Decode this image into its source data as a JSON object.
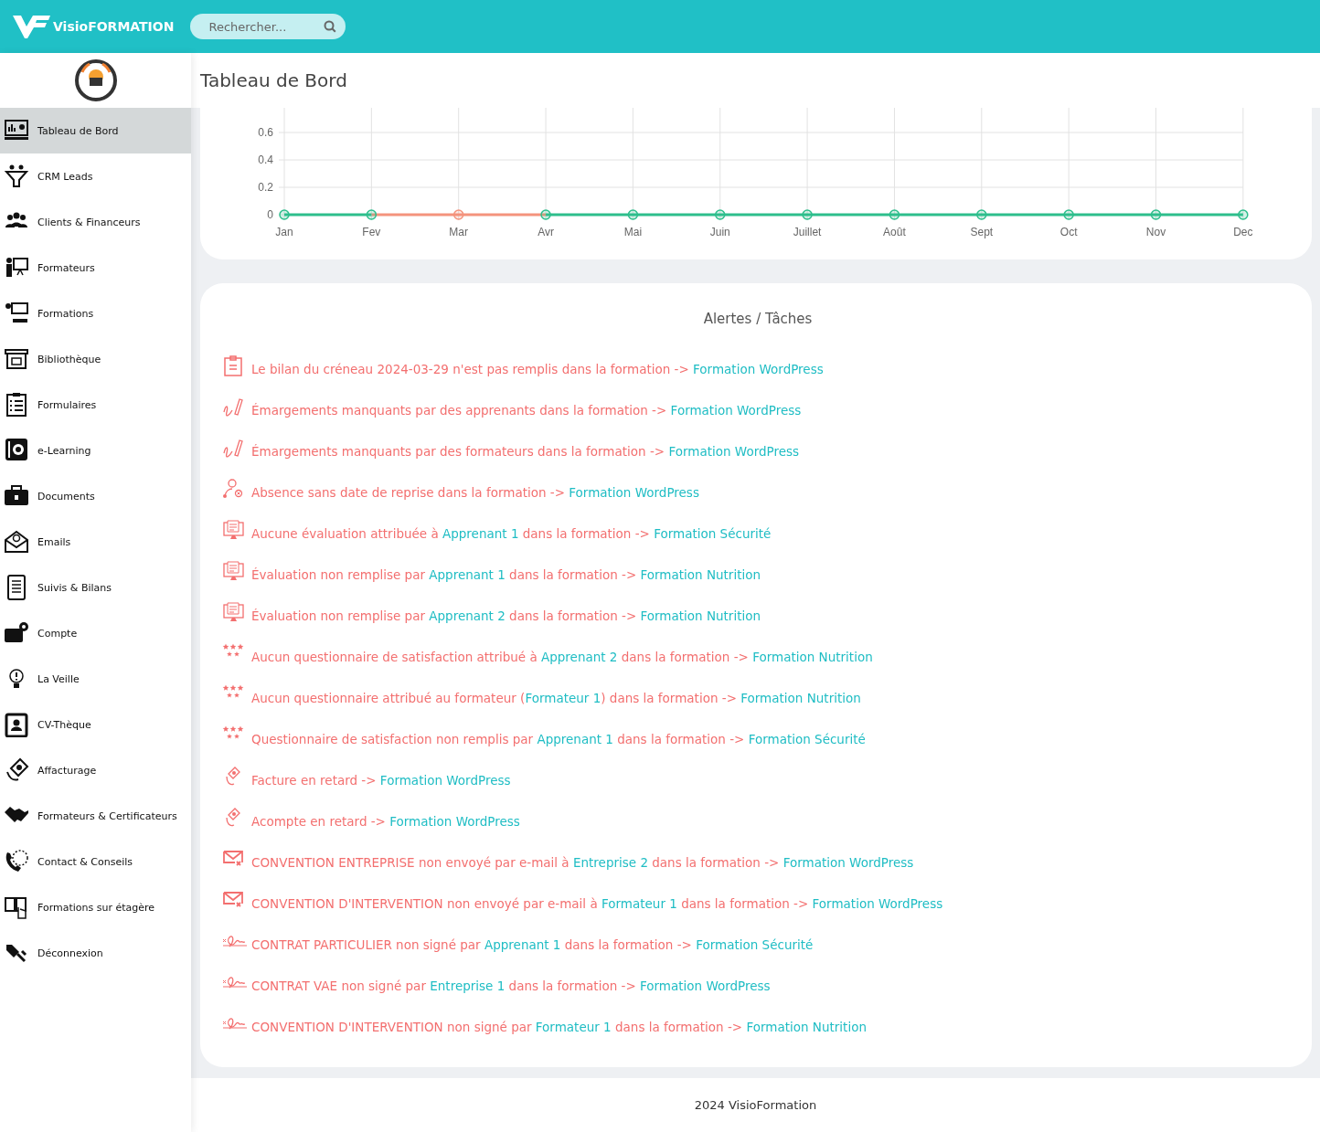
{
  "header": {
    "brand": "VisioFORMATION",
    "search": {
      "placeholder": "Rechercher..."
    }
  },
  "sidebar": {
    "items": [
      {
        "label": "Tableau de Bord",
        "selected": true
      },
      {
        "label": "CRM Leads",
        "selected": false
      },
      {
        "label": "Clients & Financeurs",
        "selected": false
      },
      {
        "label": "Formateurs",
        "selected": false
      },
      {
        "label": "Formations",
        "selected": false
      },
      {
        "label": "Bibliothèque",
        "selected": false
      },
      {
        "label": "Formulaires",
        "selected": false
      },
      {
        "label": "e-Learning",
        "selected": false
      },
      {
        "label": "Documents",
        "selected": false
      },
      {
        "label": "Emails",
        "selected": false
      },
      {
        "label": "Suivis & Bilans",
        "selected": false
      },
      {
        "label": "Compte",
        "selected": false
      },
      {
        "label": "La Veille",
        "selected": false
      },
      {
        "label": "CV-Thèque",
        "selected": false
      },
      {
        "label": "Affacturage",
        "selected": false
      },
      {
        "label": "Formateurs & Certificateurs",
        "selected": false
      },
      {
        "label": "Contact & Conseils",
        "selected": false
      },
      {
        "label": "Formations sur étagère",
        "selected": false
      },
      {
        "label": "Déconnexion",
        "selected": false
      }
    ]
  },
  "page_title": "Tableau de Bord",
  "chart_data": {
    "type": "line",
    "grid": true,
    "categories": [
      "Jan",
      "Fev",
      "Mar",
      "Avr",
      "Mai",
      "Juin",
      "Juillet",
      "Août",
      "Sept",
      "Oct",
      "Nov",
      "Dec"
    ],
    "yticks": [
      0,
      0.2,
      0.4,
      0.6
    ],
    "ylim": [
      0,
      0.78
    ],
    "series": [
      {
        "color": "#f4937c",
        "marker": true,
        "values": [
          null,
          0,
          0,
          0,
          null,
          null,
          null,
          null,
          null,
          null,
          null,
          null
        ]
      },
      {
        "color": "#2dbe8c",
        "marker": true,
        "values": [
          0,
          0,
          null,
          0,
          0,
          0,
          0,
          0,
          0,
          0,
          0,
          0
        ]
      }
    ]
  },
  "alerts": {
    "title": "Alertes / Tâches",
    "items": [
      {
        "kind": "clipboard",
        "parts": [
          {
            "text": "Le bilan du créneau 2024-03-29 n'est pas remplis dans la formation -> ",
            "link": false
          },
          {
            "text": "Formation WordPress",
            "link": true
          }
        ]
      },
      {
        "kind": "signature-pen",
        "parts": [
          {
            "text": "Émargements manquants par des apprenants dans la formation -> ",
            "link": false
          },
          {
            "text": "Formation WordPress",
            "link": true
          }
        ]
      },
      {
        "kind": "signature-pen",
        "parts": [
          {
            "text": "Émargements manquants par des formateurs dans la formation -> ",
            "link": false
          },
          {
            "text": "Formation WordPress",
            "link": true
          }
        ]
      },
      {
        "kind": "absent-person",
        "parts": [
          {
            "text": "Absence sans date de reprise dans la formation -> ",
            "link": false
          },
          {
            "text": "Formation WordPress",
            "link": true
          }
        ]
      },
      {
        "kind": "evaluation",
        "parts": [
          {
            "text": "Aucune évaluation attribuée à ",
            "link": false
          },
          {
            "text": "Apprenant 1",
            "link": true
          },
          {
            "text": " dans la formation -> ",
            "link": false
          },
          {
            "text": "Formation Sécurité",
            "link": true
          }
        ]
      },
      {
        "kind": "evaluation",
        "parts": [
          {
            "text": "Évaluation non remplise par ",
            "link": false
          },
          {
            "text": "Apprenant 1",
            "link": true
          },
          {
            "text": " dans la formation -> ",
            "link": false
          },
          {
            "text": "Formation Nutrition",
            "link": true
          }
        ]
      },
      {
        "kind": "evaluation",
        "parts": [
          {
            "text": "Évaluation non remplise par ",
            "link": false
          },
          {
            "text": "Apprenant 2",
            "link": true
          },
          {
            "text": " dans la formation -> ",
            "link": false
          },
          {
            "text": "Formation Nutrition",
            "link": true
          }
        ]
      },
      {
        "kind": "stars",
        "parts": [
          {
            "text": "Aucun questionnaire de satisfaction attribué à ",
            "link": false
          },
          {
            "text": "Apprenant 2",
            "link": true
          },
          {
            "text": " dans la formation -> ",
            "link": false
          },
          {
            "text": "Formation Nutrition",
            "link": true
          }
        ]
      },
      {
        "kind": "stars",
        "parts": [
          {
            "text": "Aucun questionnaire attribué au formateur (",
            "link": false
          },
          {
            "text": "Formateur 1",
            "link": true
          },
          {
            "text": ") dans la formation -> ",
            "link": false
          },
          {
            "text": "Formation Nutrition",
            "link": true
          }
        ]
      },
      {
        "kind": "stars",
        "parts": [
          {
            "text": "Questionnaire de satisfaction non remplis par ",
            "link": false
          },
          {
            "text": "Apprenant 1",
            "link": true
          },
          {
            "text": " dans la formation -> ",
            "link": false
          },
          {
            "text": "Formation Sécurité",
            "link": true
          }
        ]
      },
      {
        "kind": "money",
        "parts": [
          {
            "text": "Facture en retard -> ",
            "link": false
          },
          {
            "text": "Formation WordPress",
            "link": true
          }
        ]
      },
      {
        "kind": "money",
        "parts": [
          {
            "text": "Acompte en retard -> ",
            "link": false
          },
          {
            "text": "Formation WordPress",
            "link": true
          }
        ]
      },
      {
        "kind": "mail",
        "parts": [
          {
            "text": "CONVENTION ENTREPRISE non envoyé par e-mail à ",
            "link": false
          },
          {
            "text": "Entreprise 2",
            "link": true
          },
          {
            "text": " dans la formation -> ",
            "link": false
          },
          {
            "text": "Formation WordPress",
            "link": true
          }
        ]
      },
      {
        "kind": "mail",
        "parts": [
          {
            "text": "CONVENTION D'INTERVENTION non envoyé par e-mail à ",
            "link": false
          },
          {
            "text": "Formateur 1",
            "link": true
          },
          {
            "text": " dans la formation -> ",
            "link": false
          },
          {
            "text": "Formation WordPress",
            "link": true
          }
        ]
      },
      {
        "kind": "signature",
        "parts": [
          {
            "text": "CONTRAT PARTICULIER non signé par ",
            "link": false
          },
          {
            "text": "Apprenant 1",
            "link": true
          },
          {
            "text": " dans la formation -> ",
            "link": false
          },
          {
            "text": "Formation Sécurité",
            "link": true
          }
        ]
      },
      {
        "kind": "signature",
        "parts": [
          {
            "text": "CONTRAT VAE non signé par ",
            "link": false
          },
          {
            "text": "Entreprise 1",
            "link": true
          },
          {
            "text": " dans la formation -> ",
            "link": false
          },
          {
            "text": "Formation WordPress",
            "link": true
          }
        ]
      },
      {
        "kind": "signature",
        "parts": [
          {
            "text": "CONVENTION D'INTERVENTION non signé par ",
            "link": false
          },
          {
            "text": "Formateur 1",
            "link": true
          },
          {
            "text": " dans la formation -> ",
            "link": false
          },
          {
            "text": "Formation Nutrition",
            "link": true
          }
        ]
      }
    ]
  },
  "footer": "2024 VisioFormation"
}
